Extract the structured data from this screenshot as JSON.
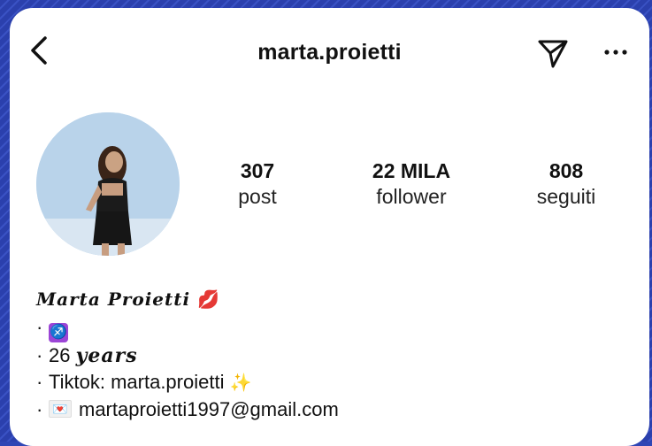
{
  "header": {
    "username": "marta.proietti",
    "back_icon": "chevron-left-icon",
    "send_icon": "paper-plane-icon",
    "more_icon": "ellipsis-icon"
  },
  "profile": {
    "avatar_alt": "profile-photo",
    "stats": [
      {
        "value": "307",
        "label": "post"
      },
      {
        "value": "22 MILA",
        "label": "follower"
      },
      {
        "value": "808",
        "label": "seguiti"
      }
    ]
  },
  "bio": {
    "name": "Marta Proietti",
    "name_emoji": "💋",
    "bullet": "·",
    "sign_emoji": "♐",
    "age_number": "26",
    "age_word": "years",
    "tiktok_text": "Tiktok: marta.proietti",
    "tiktok_emoji": "✨",
    "email_emoji": "💌",
    "email": "martaproietti1997@gmail.com"
  },
  "colors": {
    "background": "#2f46b5",
    "card": "#ffffff",
    "text": "#111111"
  }
}
